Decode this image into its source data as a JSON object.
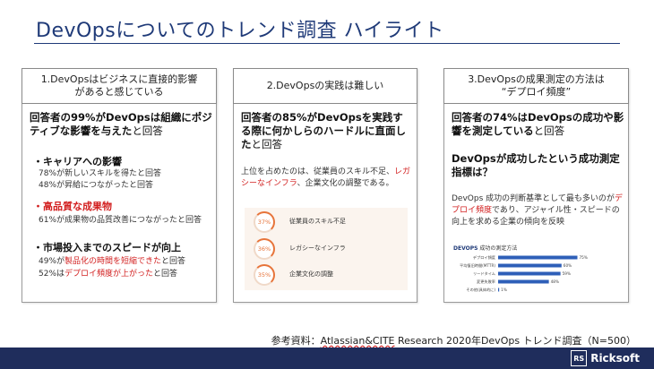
{
  "title": "DevOpsについてのトレンド調査 ハイライト",
  "columns": [
    {
      "heading_line1": "1.DevOpsはビジネスに直接的影響",
      "heading_line2": "があると感じている",
      "lead_bold": "回答者の99%がDevOpsは組織にポジティブな影響を与えた",
      "lead_tail": "と回答",
      "bullets": [
        {
          "label": "・キャリアへの影響",
          "lines": [
            "78%が新しいスキルを得たと回答",
            "48%が昇給につながったと回答"
          ]
        },
        {
          "label": "・高品質な成果物",
          "lines": [
            "61%が成果物の品質改善につながったと回答"
          ]
        },
        {
          "label": "・市場投入までのスピードが向上",
          "lines": []
        }
      ],
      "speed_line1": {
        "pre": "49%が",
        "red": "製品化の時間を短縮できた",
        "post": "と回答"
      },
      "speed_line2": {
        "pre": "52%は",
        "red": "デプロイ頻度が上がった",
        "post": "と回答"
      }
    },
    {
      "heading": "2.DevOpsの実践は難しい",
      "lead_bold": "回答者の85%がDevOpsを実践する際に何かしらのハードルに直面した",
      "lead_tail": "と回答",
      "desc_pre": "上位を占めたのは、従業員のスキル不足、",
      "desc_red": "レガシーなインフラ",
      "desc_post": "、企業文化の調整である。",
      "hurdles": [
        {
          "pct": "37%",
          "label": "従業員のスキル不足"
        },
        {
          "pct": "36%",
          "label": "レガシーなインフラ"
        },
        {
          "pct": "35%",
          "label": "企業文化の調整"
        }
      ]
    },
    {
      "heading_line1": "3.DevOpsの成果測定の方法は",
      "heading_line2": "“デプロイ頻度”",
      "lead_bold": "回答者の74%はDevOpsの成功や影響を測定している",
      "lead_tail": "と回答",
      "question": "DevOpsが成功したという成功測定指標は？",
      "desc_pre": "DevOps 成功の判断基準として最も多いのが",
      "desc_red": "デプロイ頻度",
      "desc_post": "であり、アジャイル性・スピードの向上を求める企業の傾向を反映"
    }
  ],
  "chart_data": {
    "type": "bar",
    "title_bold": "DEVOPS",
    "title_rest": " 成功の測定方法",
    "categories": [
      "デプロイ頻度",
      "平均復旧時間(MTTR)",
      "リードタイム",
      "変更失敗率",
      "その他(具体的に)"
    ],
    "values": [
      75,
      60,
      59,
      48,
      1
    ],
    "labels": [
      "75%",
      "60%",
      "59%",
      "48%",
      "1%"
    ],
    "xlim": [
      0,
      100
    ],
    "bar_color": "#2e5fb8"
  },
  "reference": {
    "pre": "参考資料：",
    "underlined": "Atlassian&CITE",
    "post": " Research  2020年DevOps トレンド調査（N=500）"
  },
  "brand": {
    "mark": "RS",
    "name": "Ricksoft"
  }
}
